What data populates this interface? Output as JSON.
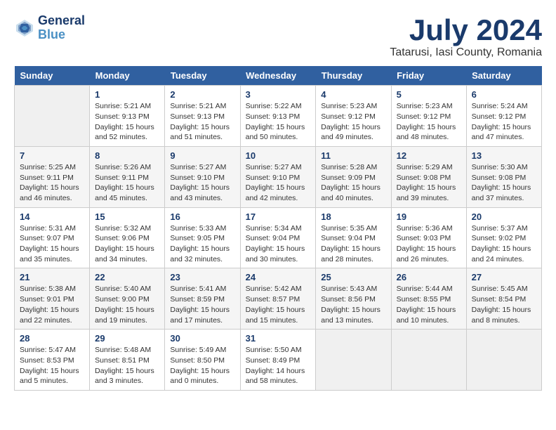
{
  "logo": {
    "line1": "General",
    "line2": "Blue"
  },
  "title": "July 2024",
  "subtitle": "Tatarusi, Iasi County, Romania",
  "days_of_week": [
    "Sunday",
    "Monday",
    "Tuesday",
    "Wednesday",
    "Thursday",
    "Friday",
    "Saturday"
  ],
  "weeks": [
    [
      {
        "day": "",
        "info": ""
      },
      {
        "day": "1",
        "info": "Sunrise: 5:21 AM\nSunset: 9:13 PM\nDaylight: 15 hours\nand 52 minutes."
      },
      {
        "day": "2",
        "info": "Sunrise: 5:21 AM\nSunset: 9:13 PM\nDaylight: 15 hours\nand 51 minutes."
      },
      {
        "day": "3",
        "info": "Sunrise: 5:22 AM\nSunset: 9:13 PM\nDaylight: 15 hours\nand 50 minutes."
      },
      {
        "day": "4",
        "info": "Sunrise: 5:23 AM\nSunset: 9:12 PM\nDaylight: 15 hours\nand 49 minutes."
      },
      {
        "day": "5",
        "info": "Sunrise: 5:23 AM\nSunset: 9:12 PM\nDaylight: 15 hours\nand 48 minutes."
      },
      {
        "day": "6",
        "info": "Sunrise: 5:24 AM\nSunset: 9:12 PM\nDaylight: 15 hours\nand 47 minutes."
      }
    ],
    [
      {
        "day": "7",
        "info": "Sunrise: 5:25 AM\nSunset: 9:11 PM\nDaylight: 15 hours\nand 46 minutes."
      },
      {
        "day": "8",
        "info": "Sunrise: 5:26 AM\nSunset: 9:11 PM\nDaylight: 15 hours\nand 45 minutes."
      },
      {
        "day": "9",
        "info": "Sunrise: 5:27 AM\nSunset: 9:10 PM\nDaylight: 15 hours\nand 43 minutes."
      },
      {
        "day": "10",
        "info": "Sunrise: 5:27 AM\nSunset: 9:10 PM\nDaylight: 15 hours\nand 42 minutes."
      },
      {
        "day": "11",
        "info": "Sunrise: 5:28 AM\nSunset: 9:09 PM\nDaylight: 15 hours\nand 40 minutes."
      },
      {
        "day": "12",
        "info": "Sunrise: 5:29 AM\nSunset: 9:08 PM\nDaylight: 15 hours\nand 39 minutes."
      },
      {
        "day": "13",
        "info": "Sunrise: 5:30 AM\nSunset: 9:08 PM\nDaylight: 15 hours\nand 37 minutes."
      }
    ],
    [
      {
        "day": "14",
        "info": "Sunrise: 5:31 AM\nSunset: 9:07 PM\nDaylight: 15 hours\nand 35 minutes."
      },
      {
        "day": "15",
        "info": "Sunrise: 5:32 AM\nSunset: 9:06 PM\nDaylight: 15 hours\nand 34 minutes."
      },
      {
        "day": "16",
        "info": "Sunrise: 5:33 AM\nSunset: 9:05 PM\nDaylight: 15 hours\nand 32 minutes."
      },
      {
        "day": "17",
        "info": "Sunrise: 5:34 AM\nSunset: 9:04 PM\nDaylight: 15 hours\nand 30 minutes."
      },
      {
        "day": "18",
        "info": "Sunrise: 5:35 AM\nSunset: 9:04 PM\nDaylight: 15 hours\nand 28 minutes."
      },
      {
        "day": "19",
        "info": "Sunrise: 5:36 AM\nSunset: 9:03 PM\nDaylight: 15 hours\nand 26 minutes."
      },
      {
        "day": "20",
        "info": "Sunrise: 5:37 AM\nSunset: 9:02 PM\nDaylight: 15 hours\nand 24 minutes."
      }
    ],
    [
      {
        "day": "21",
        "info": "Sunrise: 5:38 AM\nSunset: 9:01 PM\nDaylight: 15 hours\nand 22 minutes."
      },
      {
        "day": "22",
        "info": "Sunrise: 5:40 AM\nSunset: 9:00 PM\nDaylight: 15 hours\nand 19 minutes."
      },
      {
        "day": "23",
        "info": "Sunrise: 5:41 AM\nSunset: 8:59 PM\nDaylight: 15 hours\nand 17 minutes."
      },
      {
        "day": "24",
        "info": "Sunrise: 5:42 AM\nSunset: 8:57 PM\nDaylight: 15 hours\nand 15 minutes."
      },
      {
        "day": "25",
        "info": "Sunrise: 5:43 AM\nSunset: 8:56 PM\nDaylight: 15 hours\nand 13 minutes."
      },
      {
        "day": "26",
        "info": "Sunrise: 5:44 AM\nSunset: 8:55 PM\nDaylight: 15 hours\nand 10 minutes."
      },
      {
        "day": "27",
        "info": "Sunrise: 5:45 AM\nSunset: 8:54 PM\nDaylight: 15 hours\nand 8 minutes."
      }
    ],
    [
      {
        "day": "28",
        "info": "Sunrise: 5:47 AM\nSunset: 8:53 PM\nDaylight: 15 hours\nand 5 minutes."
      },
      {
        "day": "29",
        "info": "Sunrise: 5:48 AM\nSunset: 8:51 PM\nDaylight: 15 hours\nand 3 minutes."
      },
      {
        "day": "30",
        "info": "Sunrise: 5:49 AM\nSunset: 8:50 PM\nDaylight: 15 hours\nand 0 minutes."
      },
      {
        "day": "31",
        "info": "Sunrise: 5:50 AM\nSunset: 8:49 PM\nDaylight: 14 hours\nand 58 minutes."
      },
      {
        "day": "",
        "info": ""
      },
      {
        "day": "",
        "info": ""
      },
      {
        "day": "",
        "info": ""
      }
    ]
  ]
}
